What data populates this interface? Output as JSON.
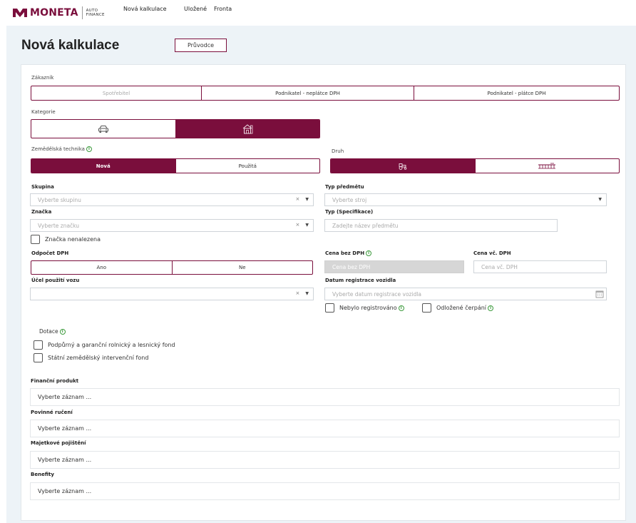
{
  "brand": {
    "name": "MONETA",
    "sub_line1": "AUTO",
    "sub_line2": "FINANCE",
    "color": "#7a0e3c"
  },
  "nav": {
    "items": [
      "Nová kalkulace",
      "Uložené",
      "Fronta"
    ]
  },
  "page": {
    "title": "Nová kalkulace",
    "guide_button": "Průvodce"
  },
  "customer": {
    "label": "Zákazník",
    "options": [
      "Spotřebitel",
      "Podnikatel - neplátce DPH",
      "Podnikatel - plátce DPH"
    ]
  },
  "category": {
    "label": "Kategorie",
    "icons": [
      "car-icon",
      "agricultural-building-icon"
    ],
    "active_index": 1
  },
  "machinery": {
    "label": "Zemědělská technika",
    "options": [
      "Nová",
      "Použitá"
    ],
    "active_index": 0
  },
  "kind": {
    "label": "Druh",
    "icons": [
      "tractor-icon",
      "harvester-icon"
    ],
    "active_index": 0
  },
  "group": {
    "label": "Skupina",
    "placeholder": "Vyberte skupinu"
  },
  "subject_type": {
    "label": "Typ předmětu",
    "placeholder": "Vyberte stroj"
  },
  "make": {
    "label": "Značka",
    "placeholder": "Vyberte značku",
    "not_found": "Značka nenalezena"
  },
  "spec": {
    "label": "Typ (Specifikace)",
    "placeholder": "Zadejte název předmětu"
  },
  "vat": {
    "label": "Odpočet DPH",
    "options": [
      "Ano",
      "Ne"
    ]
  },
  "price_net": {
    "label": "Cena bez DPH",
    "placeholder": "Cena bez DPH"
  },
  "price_gross": {
    "label": "Cena vč. DPH",
    "placeholder": "Cena vč. DPH"
  },
  "usage": {
    "label": "Účel použití vozu",
    "placeholder": ""
  },
  "registration": {
    "label": "Datum registrace vozidla",
    "placeholder": "Vyberte datum registrace vozidla",
    "not_registered": "Nebylo registrováno",
    "deferred": "Odložené čerpání"
  },
  "subsidy": {
    "label": "Dotace",
    "options": [
      "Podpůrný a garanční rolnický a lesnický fond",
      "Státní zemědělský intervenční fond"
    ]
  },
  "products": [
    {
      "label": "Finanční produkt",
      "value": "Vyberte záznam ..."
    },
    {
      "label": "Povinné ručení",
      "value": "Vyberte záznam ..."
    },
    {
      "label": "Majetkové pojištění",
      "value": "Vyberte záznam ..."
    },
    {
      "label": "Benefity",
      "value": "Vyberte záznam ..."
    }
  ],
  "select_clear_symbol": "×",
  "select_arrow_symbol": "▼",
  "info_symbol": "i"
}
